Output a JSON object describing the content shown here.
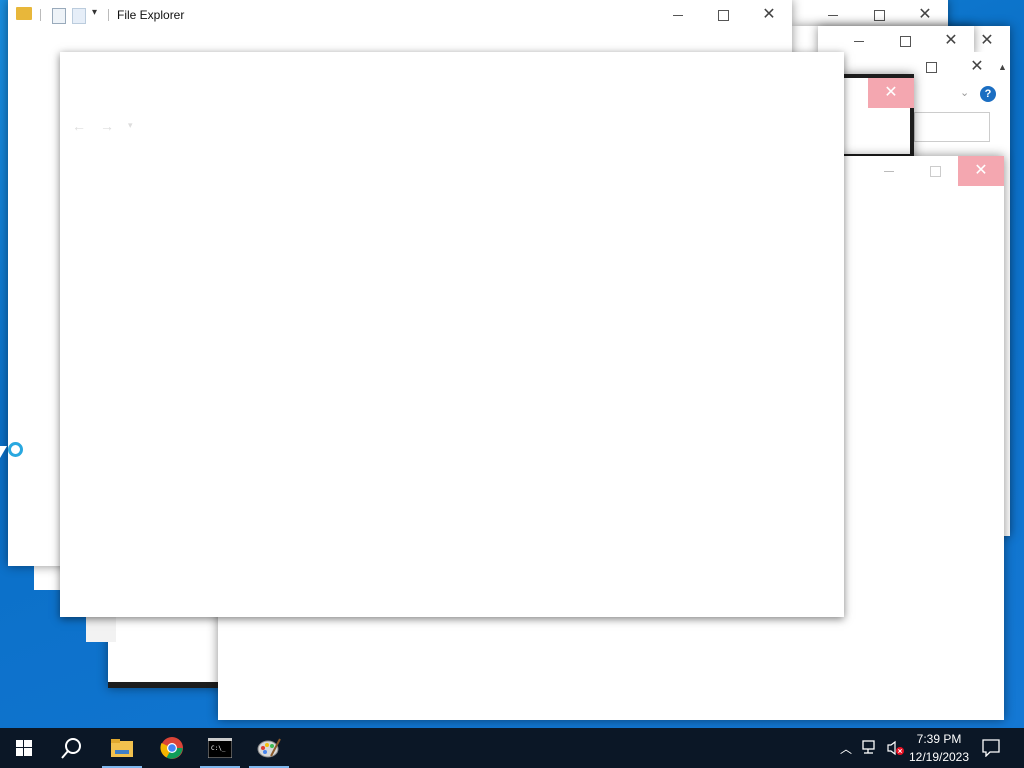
{
  "explorer": {
    "title": "File Explorer",
    "controls": {
      "minimize": "–",
      "maximize": "□",
      "close": "✕"
    }
  },
  "help_badge": "?",
  "taskbar": {
    "items": [
      {
        "name": "start-button",
        "icon": "windows-logo-icon"
      },
      {
        "name": "search-button",
        "icon": "search-icon"
      },
      {
        "name": "file-explorer-button",
        "icon": "folder-icon",
        "active": true
      },
      {
        "name": "chrome-button",
        "icon": "chrome-icon"
      },
      {
        "name": "terminal-button",
        "icon": "terminal-icon",
        "active": true
      },
      {
        "name": "paint-button",
        "icon": "paint-palette-icon",
        "active": true
      }
    ],
    "time": "7:39 PM",
    "date": "12/19/2023"
  },
  "colors": {
    "desktop": "#1478d4",
    "taskbar": "#0b1726",
    "close_hover": "#f4a7b0",
    "help": "#1b6ec2"
  }
}
